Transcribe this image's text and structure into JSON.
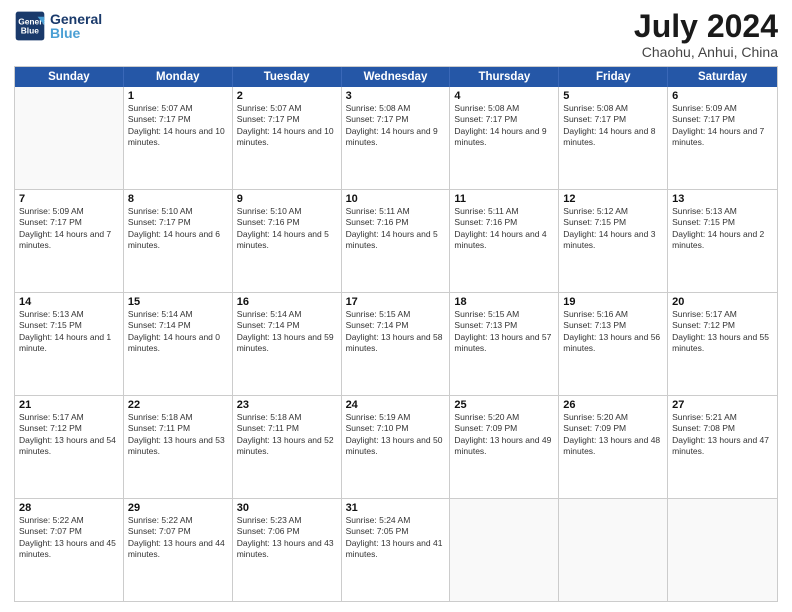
{
  "header": {
    "logo_line1": "General",
    "logo_line2": "Blue",
    "month_year": "July 2024",
    "location": "Chaohu, Anhui, China"
  },
  "weekdays": [
    "Sunday",
    "Monday",
    "Tuesday",
    "Wednesday",
    "Thursday",
    "Friday",
    "Saturday"
  ],
  "rows": [
    [
      {
        "day": "",
        "sunrise": "",
        "sunset": "",
        "daylight": ""
      },
      {
        "day": "1",
        "sunrise": "5:07 AM",
        "sunset": "7:17 PM",
        "daylight": "14 hours and 10 minutes."
      },
      {
        "day": "2",
        "sunrise": "5:07 AM",
        "sunset": "7:17 PM",
        "daylight": "14 hours and 10 minutes."
      },
      {
        "day": "3",
        "sunrise": "5:08 AM",
        "sunset": "7:17 PM",
        "daylight": "14 hours and 9 minutes."
      },
      {
        "day": "4",
        "sunrise": "5:08 AM",
        "sunset": "7:17 PM",
        "daylight": "14 hours and 9 minutes."
      },
      {
        "day": "5",
        "sunrise": "5:08 AM",
        "sunset": "7:17 PM",
        "daylight": "14 hours and 8 minutes."
      },
      {
        "day": "6",
        "sunrise": "5:09 AM",
        "sunset": "7:17 PM",
        "daylight": "14 hours and 7 minutes."
      }
    ],
    [
      {
        "day": "7",
        "sunrise": "5:09 AM",
        "sunset": "7:17 PM",
        "daylight": "14 hours and 7 minutes."
      },
      {
        "day": "8",
        "sunrise": "5:10 AM",
        "sunset": "7:17 PM",
        "daylight": "14 hours and 6 minutes."
      },
      {
        "day": "9",
        "sunrise": "5:10 AM",
        "sunset": "7:16 PM",
        "daylight": "14 hours and 5 minutes."
      },
      {
        "day": "10",
        "sunrise": "5:11 AM",
        "sunset": "7:16 PM",
        "daylight": "14 hours and 5 minutes."
      },
      {
        "day": "11",
        "sunrise": "5:11 AM",
        "sunset": "7:16 PM",
        "daylight": "14 hours and 4 minutes."
      },
      {
        "day": "12",
        "sunrise": "5:12 AM",
        "sunset": "7:15 PM",
        "daylight": "14 hours and 3 minutes."
      },
      {
        "day": "13",
        "sunrise": "5:13 AM",
        "sunset": "7:15 PM",
        "daylight": "14 hours and 2 minutes."
      }
    ],
    [
      {
        "day": "14",
        "sunrise": "5:13 AM",
        "sunset": "7:15 PM",
        "daylight": "14 hours and 1 minute."
      },
      {
        "day": "15",
        "sunrise": "5:14 AM",
        "sunset": "7:14 PM",
        "daylight": "14 hours and 0 minutes."
      },
      {
        "day": "16",
        "sunrise": "5:14 AM",
        "sunset": "7:14 PM",
        "daylight": "13 hours and 59 minutes."
      },
      {
        "day": "17",
        "sunrise": "5:15 AM",
        "sunset": "7:14 PM",
        "daylight": "13 hours and 58 minutes."
      },
      {
        "day": "18",
        "sunrise": "5:15 AM",
        "sunset": "7:13 PM",
        "daylight": "13 hours and 57 minutes."
      },
      {
        "day": "19",
        "sunrise": "5:16 AM",
        "sunset": "7:13 PM",
        "daylight": "13 hours and 56 minutes."
      },
      {
        "day": "20",
        "sunrise": "5:17 AM",
        "sunset": "7:12 PM",
        "daylight": "13 hours and 55 minutes."
      }
    ],
    [
      {
        "day": "21",
        "sunrise": "5:17 AM",
        "sunset": "7:12 PM",
        "daylight": "13 hours and 54 minutes."
      },
      {
        "day": "22",
        "sunrise": "5:18 AM",
        "sunset": "7:11 PM",
        "daylight": "13 hours and 53 minutes."
      },
      {
        "day": "23",
        "sunrise": "5:18 AM",
        "sunset": "7:11 PM",
        "daylight": "13 hours and 52 minutes."
      },
      {
        "day": "24",
        "sunrise": "5:19 AM",
        "sunset": "7:10 PM",
        "daylight": "13 hours and 50 minutes."
      },
      {
        "day": "25",
        "sunrise": "5:20 AM",
        "sunset": "7:09 PM",
        "daylight": "13 hours and 49 minutes."
      },
      {
        "day": "26",
        "sunrise": "5:20 AM",
        "sunset": "7:09 PM",
        "daylight": "13 hours and 48 minutes."
      },
      {
        "day": "27",
        "sunrise": "5:21 AM",
        "sunset": "7:08 PM",
        "daylight": "13 hours and 47 minutes."
      }
    ],
    [
      {
        "day": "28",
        "sunrise": "5:22 AM",
        "sunset": "7:07 PM",
        "daylight": "13 hours and 45 minutes."
      },
      {
        "day": "29",
        "sunrise": "5:22 AM",
        "sunset": "7:07 PM",
        "daylight": "13 hours and 44 minutes."
      },
      {
        "day": "30",
        "sunrise": "5:23 AM",
        "sunset": "7:06 PM",
        "daylight": "13 hours and 43 minutes."
      },
      {
        "day": "31",
        "sunrise": "5:24 AM",
        "sunset": "7:05 PM",
        "daylight": "13 hours and 41 minutes."
      },
      {
        "day": "",
        "sunrise": "",
        "sunset": "",
        "daylight": ""
      },
      {
        "day": "",
        "sunrise": "",
        "sunset": "",
        "daylight": ""
      },
      {
        "day": "",
        "sunrise": "",
        "sunset": "",
        "daylight": ""
      }
    ]
  ],
  "labels": {
    "sunrise": "Sunrise:",
    "sunset": "Sunset:",
    "daylight": "Daylight hours"
  }
}
